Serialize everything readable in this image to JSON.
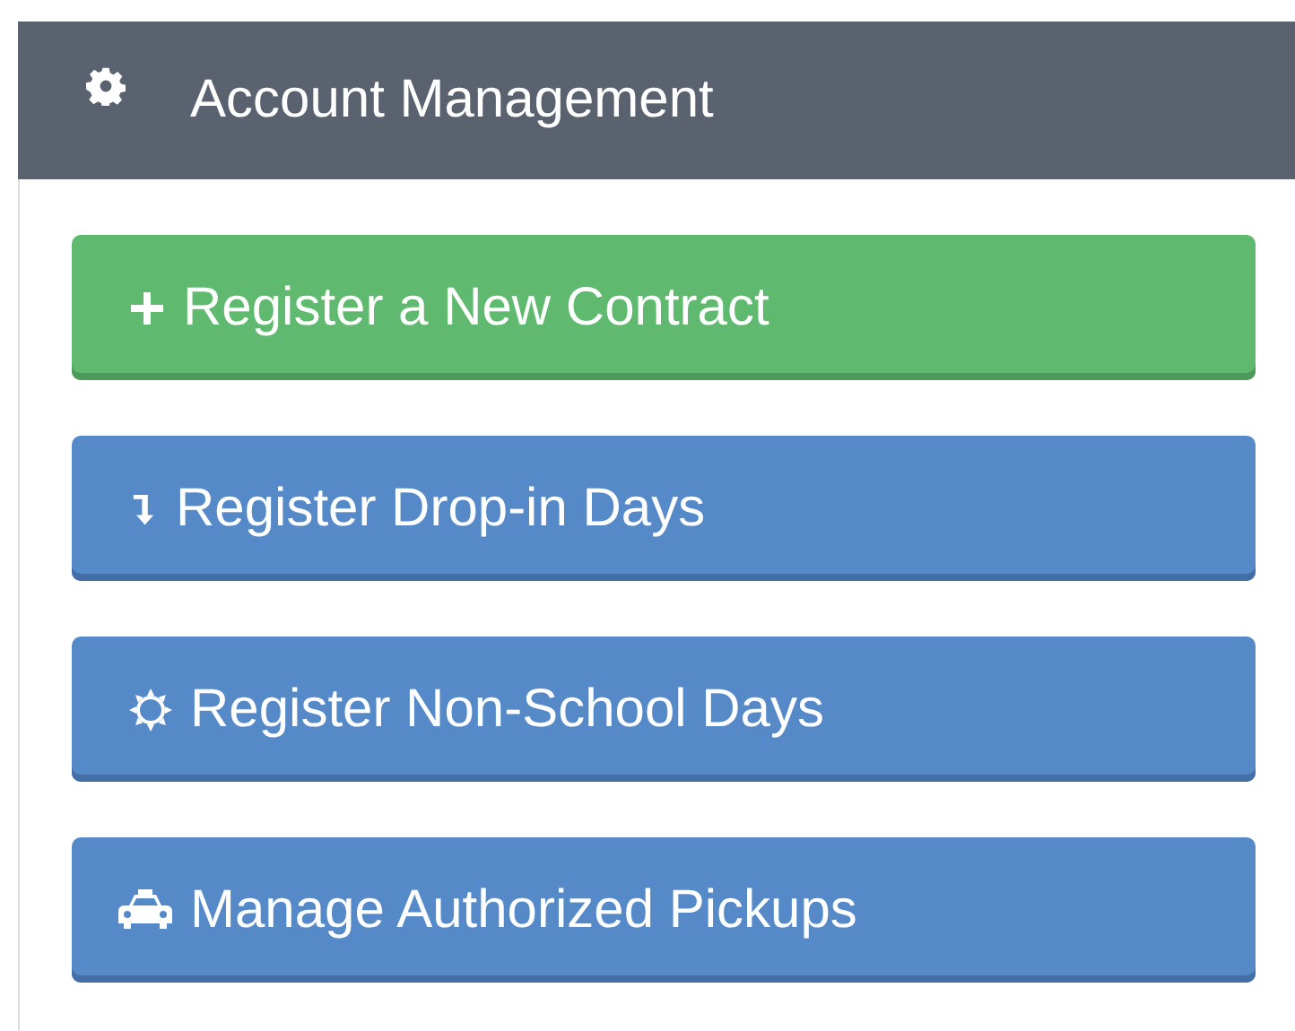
{
  "panel": {
    "title": "Account Management"
  },
  "buttons": [
    {
      "label": "Register a New Contract",
      "kind": "success"
    },
    {
      "label": "Register Drop-in Days",
      "kind": "primary"
    },
    {
      "label": "Register Non-School Days",
      "kind": "primary"
    },
    {
      "label": "Manage Authorized Pickups",
      "kind": "primary"
    }
  ]
}
